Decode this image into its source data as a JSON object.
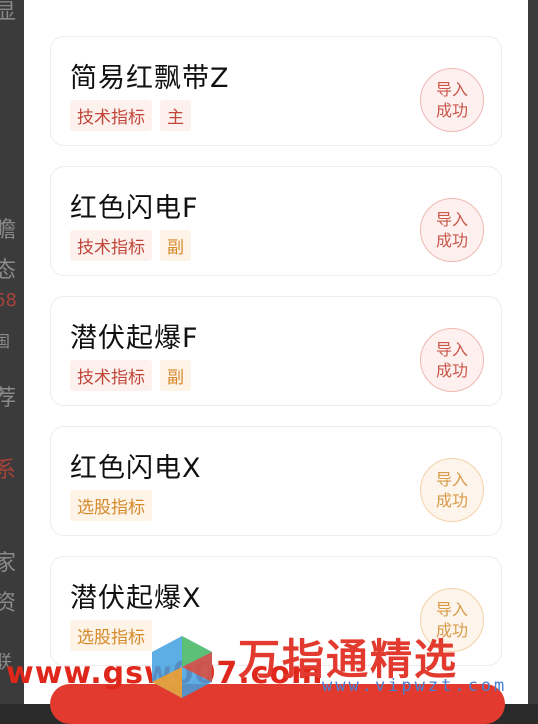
{
  "background_fragments": [
    "显",
    "瞻",
    "态",
    "68",
    "国",
    "荐",
    "系",
    "家",
    "资",
    "联"
  ],
  "cards": [
    {
      "title": "简易红飘带Z",
      "tags": [
        {
          "text": "技术指标",
          "tone": "red"
        },
        {
          "text": "主",
          "tone": "red"
        }
      ],
      "status": [
        "导入",
        "成功"
      ],
      "status_tone": "red"
    },
    {
      "title": "红色闪电F",
      "tags": [
        {
          "text": "技术指标",
          "tone": "red"
        },
        {
          "text": "副",
          "tone": "orange"
        }
      ],
      "status": [
        "导入",
        "成功"
      ],
      "status_tone": "red"
    },
    {
      "title": "潜伏起爆F",
      "tags": [
        {
          "text": "技术指标",
          "tone": "red"
        },
        {
          "text": "副",
          "tone": "orange"
        }
      ],
      "status": [
        "导入",
        "成功"
      ],
      "status_tone": "red"
    },
    {
      "title": "红色闪电X",
      "tags": [
        {
          "text": "选股指标",
          "tone": "orange"
        }
      ],
      "status": [
        "导入",
        "成功"
      ],
      "status_tone": "orange"
    },
    {
      "title": "潜伏起爆X",
      "tags": [
        {
          "text": "选股指标",
          "tone": "orange"
        }
      ],
      "status": [
        "导入",
        "成功"
      ],
      "status_tone": "orange"
    }
  ],
  "watermark": {
    "url": "www.gsw007.com",
    "title": "万指通精选",
    "subtitle": "www.vipwzt.com"
  },
  "colors": {
    "accent_red": "#e23a2e",
    "tag_red": "#c0463a",
    "tag_orange": "#d58a2c"
  }
}
